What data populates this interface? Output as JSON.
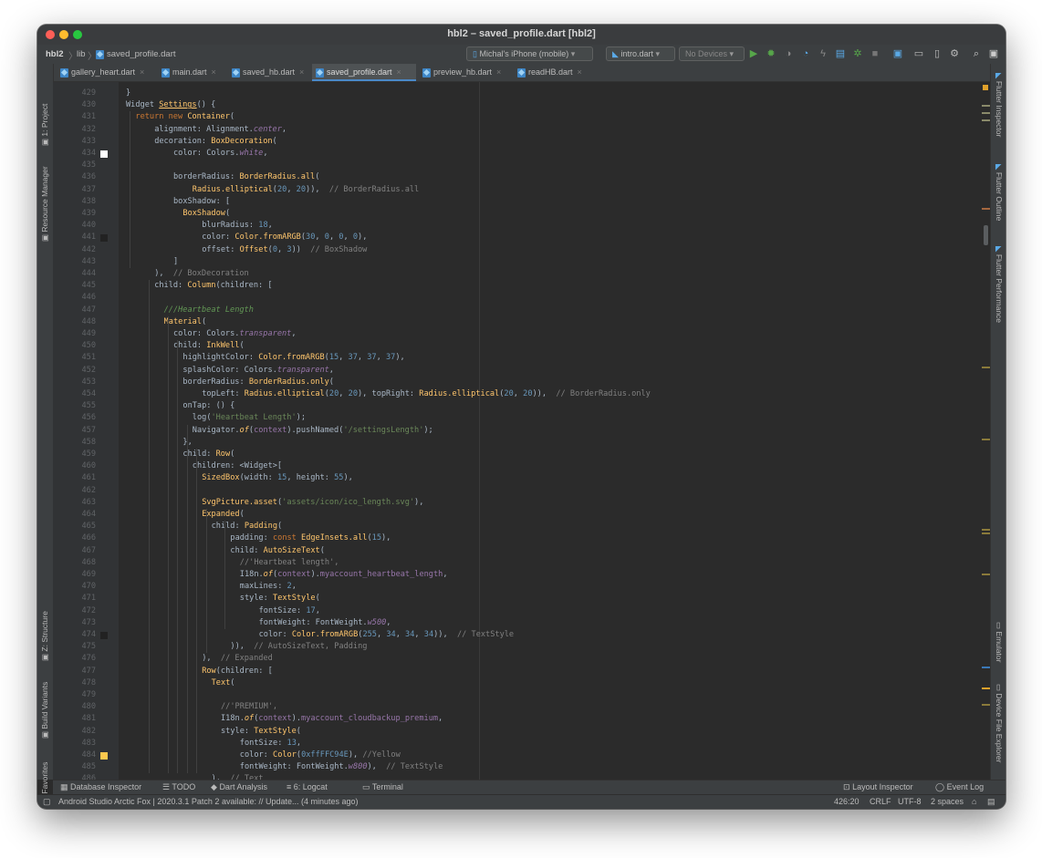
{
  "window": {
    "title": "hbl2 – saved_profile.dart [hbl2]"
  },
  "breadcrumb": [
    "hbl2",
    "lib",
    "saved_profile.dart"
  ],
  "toolbar": {
    "device": "Michal's iPhone (mobile)",
    "config": "intro.dart",
    "devices": "No Devices"
  },
  "tabs": [
    {
      "label": "gallery_heart.dart",
      "active": false
    },
    {
      "label": "main.dart",
      "active": false
    },
    {
      "label": "saved_hb.dart",
      "active": false
    },
    {
      "label": "saved_profile.dart",
      "active": true
    },
    {
      "label": "preview_hb.dart",
      "active": false
    },
    {
      "label": "readHB.dart",
      "active": false
    }
  ],
  "left_panels": {
    "project": "1: Project",
    "resource": "Resource Manager",
    "structure": "Z: Structure",
    "build": "Build Variants",
    "favorites": "2: Favorites"
  },
  "right_panels": {
    "inspector": "Flutter Inspector",
    "outline": "Flutter Outline",
    "performance": "Flutter Performance",
    "emulator": "Emulator",
    "explorer": "Device File Explorer"
  },
  "code": {
    "colors": {
      "white": "#ffffff",
      "dark": "#222222",
      "yellow": "#ffc94e"
    },
    "lines": [
      {
        "n": "429",
        "x": 0,
        "h": "}"
      },
      {
        "n": "430",
        "x": 0,
        "h": "Widget <span class=\"f\"><u>Settings</u></span>() {"
      },
      {
        "n": "431",
        "x": 1,
        "h": "<span class=\"k\">return new </span><span class=\"f\">Container</span>("
      },
      {
        "n": "432",
        "x": 3,
        "h": "alignment: Alignment.<span class=\"p\">center</span>,"
      },
      {
        "n": "433",
        "x": 3,
        "h": "decoration: <span class=\"f\">BoxDecoration</span>("
      },
      {
        "n": "434",
        "x": 5,
        "h": "color: Colors.<span class=\"p\">white</span>,",
        "sw": "white"
      },
      {
        "n": "435",
        "x": 0,
        "h": ""
      },
      {
        "n": "436",
        "x": 5,
        "h": "borderRadius: <span class=\"f\">BorderRadius.all</span>("
      },
      {
        "n": "437",
        "x": 7,
        "h": "<span class=\"f\">Radius.elliptical</span>(<span class=\"n\">20</span>, <span class=\"n\">20</span>)),  <span class=\"c\">// BorderRadius.all</span>"
      },
      {
        "n": "438",
        "x": 5,
        "h": "boxShadow: ["
      },
      {
        "n": "439",
        "x": 6,
        "h": "<span class=\"f\">BoxShadow</span>("
      },
      {
        "n": "440",
        "x": 8,
        "h": "blurRadius: <span class=\"n\">18</span>,"
      },
      {
        "n": "441",
        "x": 8,
        "h": "color: <span class=\"f\">Color.fromARGB</span>(<span class=\"n\">30</span>, <span class=\"n\">0</span>, <span class=\"n\">0</span>, <span class=\"n\">0</span>),",
        "sw": "dark"
      },
      {
        "n": "442",
        "x": 8,
        "h": "offset: <span class=\"f\">Offset</span>(<span class=\"n\">0</span>, <span class=\"n\">3</span>))  <span class=\"c\">// BoxShadow</span>"
      },
      {
        "n": "443",
        "x": 5,
        "h": "]"
      },
      {
        "n": "444",
        "x": 3,
        "h": "),  <span class=\"c\">// BoxDecoration</span>"
      },
      {
        "n": "445",
        "x": 3,
        "h": "child: <span class=\"f\">Column</span>(children: ["
      },
      {
        "n": "446",
        "x": 0,
        "h": ""
      },
      {
        "n": "447",
        "x": 4,
        "h": "<span class=\"dc\">///Heartbeat Length</span>"
      },
      {
        "n": "448",
        "x": 4,
        "h": "<span class=\"f\">Material</span>("
      },
      {
        "n": "449",
        "x": 5,
        "h": "color: Colors.<span class=\"p\">transparent</span>,"
      },
      {
        "n": "450",
        "x": 5,
        "h": "child: <span class=\"f\">InkWell</span>("
      },
      {
        "n": "451",
        "x": 6,
        "h": "highlightColor: <span class=\"f\">Color.fromARGB</span>(<span class=\"n\">15</span>, <span class=\"n\">37</span>, <span class=\"n\">37</span>, <span class=\"n\">37</span>),"
      },
      {
        "n": "452",
        "x": 6,
        "h": "splashColor: Colors.<span class=\"p\">transparent</span>,"
      },
      {
        "n": "453",
        "x": 6,
        "h": "borderRadius: <span class=\"f\">BorderRadius.only</span>("
      },
      {
        "n": "454",
        "x": 8,
        "h": "topLeft: <span class=\"f\">Radius.elliptical</span>(<span class=\"n\">20</span>, <span class=\"n\">20</span>), topRight: <span class=\"f\">Radius.elliptical</span>(<span class=\"n\">20</span>, <span class=\"n\">20</span>)),  <span class=\"c\">// BorderRadius.only</span>"
      },
      {
        "n": "455",
        "x": 6,
        "h": "onTap: () {"
      },
      {
        "n": "456",
        "x": 7,
        "h": "log(<span class=\"s\">'Heartbeat Length'</span>);"
      },
      {
        "n": "457",
        "x": 7,
        "h": "Navigator.<span class=\"f\"><i>of</i></span>(<span class=\"pv\">context</span>).pushNamed(<span class=\"s\">'/settingsLength'</span>);"
      },
      {
        "n": "458",
        "x": 6,
        "h": "},"
      },
      {
        "n": "459",
        "x": 6,
        "h": "child: <span class=\"f\">Row</span>("
      },
      {
        "n": "460",
        "x": 7,
        "h": "children: &lt;Widget&gt;["
      },
      {
        "n": "461",
        "x": 8,
        "h": "<span class=\"f\">SizedBox</span>(width: <span class=\"n\">15</span>, height: <span class=\"n\">55</span>),"
      },
      {
        "n": "462",
        "x": 0,
        "h": ""
      },
      {
        "n": "463",
        "x": 8,
        "h": "<span class=\"f\">SvgPicture.asset</span>(<span class=\"s\">'assets/icon/ico_length.svg'</span>),"
      },
      {
        "n": "464",
        "x": 8,
        "h": "<span class=\"f\">Expanded</span>("
      },
      {
        "n": "465",
        "x": 9,
        "h": "child: <span class=\"f\">Padding</span>("
      },
      {
        "n": "466",
        "x": 11,
        "h": "padding: <span class=\"k\">const </span><span class=\"f\">EdgeInsets.all</span>(<span class=\"n\">15</span>),"
      },
      {
        "n": "467",
        "x": 11,
        "h": "child: <span class=\"f\">AutoSizeText</span>("
      },
      {
        "n": "468",
        "x": 12,
        "h": "<span class=\"c\">//'Heartbeat length',</span>"
      },
      {
        "n": "469",
        "x": 12,
        "h": "I18n.<span class=\"f\"><i>of</i></span>(<span class=\"pv\">context</span>).<span class=\"pv\">myaccount_heartbeat_length</span>,"
      },
      {
        "n": "470",
        "x": 12,
        "h": "maxLines: <span class=\"n\">2</span>,"
      },
      {
        "n": "471",
        "x": 12,
        "h": "style: <span class=\"f\">TextStyle</span>("
      },
      {
        "n": "472",
        "x": 14,
        "h": "fontSize: <span class=\"n\">17</span>,"
      },
      {
        "n": "473",
        "x": 14,
        "h": "fontWeight: FontWeight.<span class=\"p\">w500</span>,"
      },
      {
        "n": "474",
        "x": 14,
        "h": "color: <span class=\"f\">Color.fromARGB</span>(<span class=\"n\">255</span>, <span class=\"n\">34</span>, <span class=\"n\">34</span>, <span class=\"n\">34</span>)),  <span class=\"c\">// TextStyle</span>",
        "sw": "dark"
      },
      {
        "n": "475",
        "x": 11,
        "h": ")),  <span class=\"c\">// AutoSizeText, Padding</span>"
      },
      {
        "n": "476",
        "x": 8,
        "h": "),  <span class=\"c\">// Expanded</span>"
      },
      {
        "n": "477",
        "x": 8,
        "h": "<span class=\"f\">Row</span>(children: ["
      },
      {
        "n": "478",
        "x": 9,
        "h": "<span class=\"f\">Text</span>("
      },
      {
        "n": "479",
        "x": 0,
        "h": ""
      },
      {
        "n": "480",
        "x": 10,
        "h": "<span class=\"c\">//'PREMIUM',</span>"
      },
      {
        "n": "481",
        "x": 10,
        "h": "I18n.<span class=\"f\"><i>of</i></span>(<span class=\"pv\">context</span>).<span class=\"pv\">myaccount_cloudbackup_premium</span>,"
      },
      {
        "n": "482",
        "x": 10,
        "h": "style: <span class=\"f\">TextStyle</span>("
      },
      {
        "n": "483",
        "x": 12,
        "h": "fontSize: <span class=\"n\">13</span>,"
      },
      {
        "n": "484",
        "x": 12,
        "h": "color: <span class=\"f\">Color</span>(<span class=\"n\">0xffFFC94E</span>), <span class=\"c\">//Yellow</span>",
        "sw": "yellow"
      },
      {
        "n": "485",
        "x": 12,
        "h": "fontWeight: FontWeight.<span class=\"p\">w800</span>),  <span class=\"c\">// TextStyle</span>"
      },
      {
        "n": "486",
        "x": 9,
        "h": "),  <span class=\"c\">// Text</span>"
      }
    ]
  },
  "bottom_tabs": {
    "db": "Database Inspector",
    "todo": "TODO",
    "dart": "Dart Analysis",
    "logcat": "6: Logcat",
    "terminal": "Terminal",
    "layout": "Layout Inspector",
    "event": "Event Log"
  },
  "status": {
    "message": "Android Studio Arctic Fox | 2020.3.1 Patch 2 available: // Update... (4 minutes ago)",
    "position": "426:20",
    "line_sep": "CRLF",
    "encoding": "UTF-8",
    "indent": "2 spaces"
  }
}
